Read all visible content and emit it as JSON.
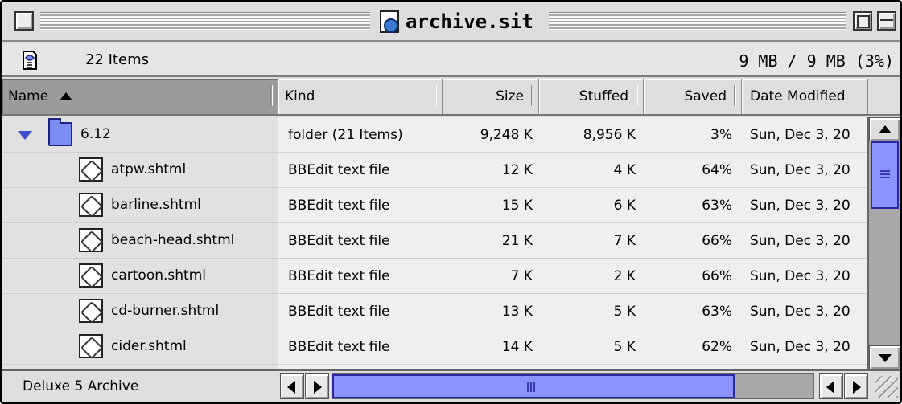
{
  "window": {
    "title": "archive.sit"
  },
  "info": {
    "items_count": "22 Items",
    "size": "9 MB / 9 MB (3%)"
  },
  "columns": {
    "name": "Name",
    "kind": "Kind",
    "size": "Size",
    "stuffed": "Stuffed",
    "saved": "Saved",
    "date": "Date Modified",
    "sorted_by": "name"
  },
  "folder": {
    "name": "6.12",
    "kind": "folder (21 Items)",
    "size": "9,248 K",
    "stuffed": "8,956 K",
    "saved": "3%",
    "date": "Sun, Dec 3, 20",
    "expanded": true
  },
  "files": [
    {
      "name": "atpw.shtml",
      "kind": "BBEdit text file",
      "size": "12 K",
      "stuffed": "4 K",
      "saved": "64%",
      "date": "Sun, Dec 3, 20"
    },
    {
      "name": "barline.shtml",
      "kind": "BBEdit text file",
      "size": "15 K",
      "stuffed": "6 K",
      "saved": "63%",
      "date": "Sun, Dec 3, 20"
    },
    {
      "name": "beach-head.shtml",
      "kind": "BBEdit text file",
      "size": "21 K",
      "stuffed": "7 K",
      "saved": "66%",
      "date": "Sun, Dec 3, 20"
    },
    {
      "name": "cartoon.shtml",
      "kind": "BBEdit text file",
      "size": "7 K",
      "stuffed": "2 K",
      "saved": "66%",
      "date": "Sun, Dec 3, 20"
    },
    {
      "name": "cd-burner.shtml",
      "kind": "BBEdit text file",
      "size": "13 K",
      "stuffed": "5 K",
      "saved": "63%",
      "date": "Sun, Dec 3, 20"
    },
    {
      "name": "cider.shtml",
      "kind": "BBEdit text file",
      "size": "14 K",
      "stuffed": "5 K",
      "saved": "62%",
      "date": "Sun, Dec 3, 20"
    }
  ],
  "status": {
    "label": "Deluxe 5 Archive"
  },
  "icons": {
    "window_doc": "stuffit-document-icon",
    "info": "stuffit-spring-icon",
    "folder": "folder-icon",
    "file": "bbedit-document-icon"
  },
  "colors": {
    "scroll_thumb": "#8c93ff",
    "folder": "#7b8cf2",
    "disclosure": "#3b4fd0"
  }
}
